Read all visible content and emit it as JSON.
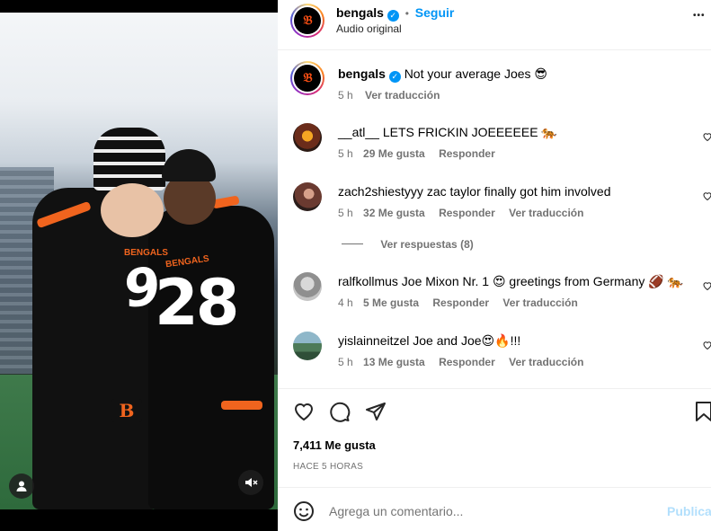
{
  "header": {
    "username": "bengals",
    "follow_label": "Seguir",
    "separator": "•",
    "audio": "Audio original",
    "more": "•••"
  },
  "caption": {
    "username": "bengals",
    "text": "Not your average Joes 😎",
    "time": "5 h",
    "translate": "Ver traducción"
  },
  "comments": [
    {
      "username": "__atl__",
      "text": "LETS FRICKIN JOEEEEEE 🐅",
      "time": "5 h",
      "likes": "29 Me gusta",
      "reply": "Responder",
      "translate": ""
    },
    {
      "username": "zach2shiestyyy",
      "text": "zac taylor finally got him involved",
      "time": "5 h",
      "likes": "32 Me gusta",
      "reply": "Responder",
      "translate": "Ver traducción"
    },
    {
      "username": "ralfkollmus",
      "text": "Joe Mixon Nr. 1 😍 greetings from Germany 🏈 🐅",
      "time": "4 h",
      "likes": "5 Me gusta",
      "reply": "Responder",
      "translate": "Ver traducción"
    },
    {
      "username": "yislainneitzel",
      "text": "Joe and Joe😍🔥!!!",
      "time": "5 h",
      "likes": "13 Me gusta",
      "reply": "Responder",
      "translate": "Ver traducción"
    }
  ],
  "replies_toggle": "Ver respuestas (8)",
  "likes_count": "7,411 Me gusta",
  "posted": "HACE 5 HORAS",
  "add_comment": {
    "placeholder": "Agrega un comentario...",
    "publish": "Publicar"
  },
  "media": {
    "jersey_left": "9",
    "jersey_right": "28",
    "jersey_text": "BENGALS",
    "logo_text": "B"
  },
  "icons": {
    "verified": "verified-badge-icon",
    "like": "heart-icon",
    "comment": "comment-bubble-icon",
    "share": "paper-plane-icon",
    "save": "bookmark-icon",
    "emoji": "smiley-icon",
    "mute": "speaker-muted-icon",
    "tags": "user-tag-icon"
  },
  "colors": {
    "link_blue": "#0095f6",
    "muted": "#737373",
    "bengals_orange": "#fb4f14"
  }
}
